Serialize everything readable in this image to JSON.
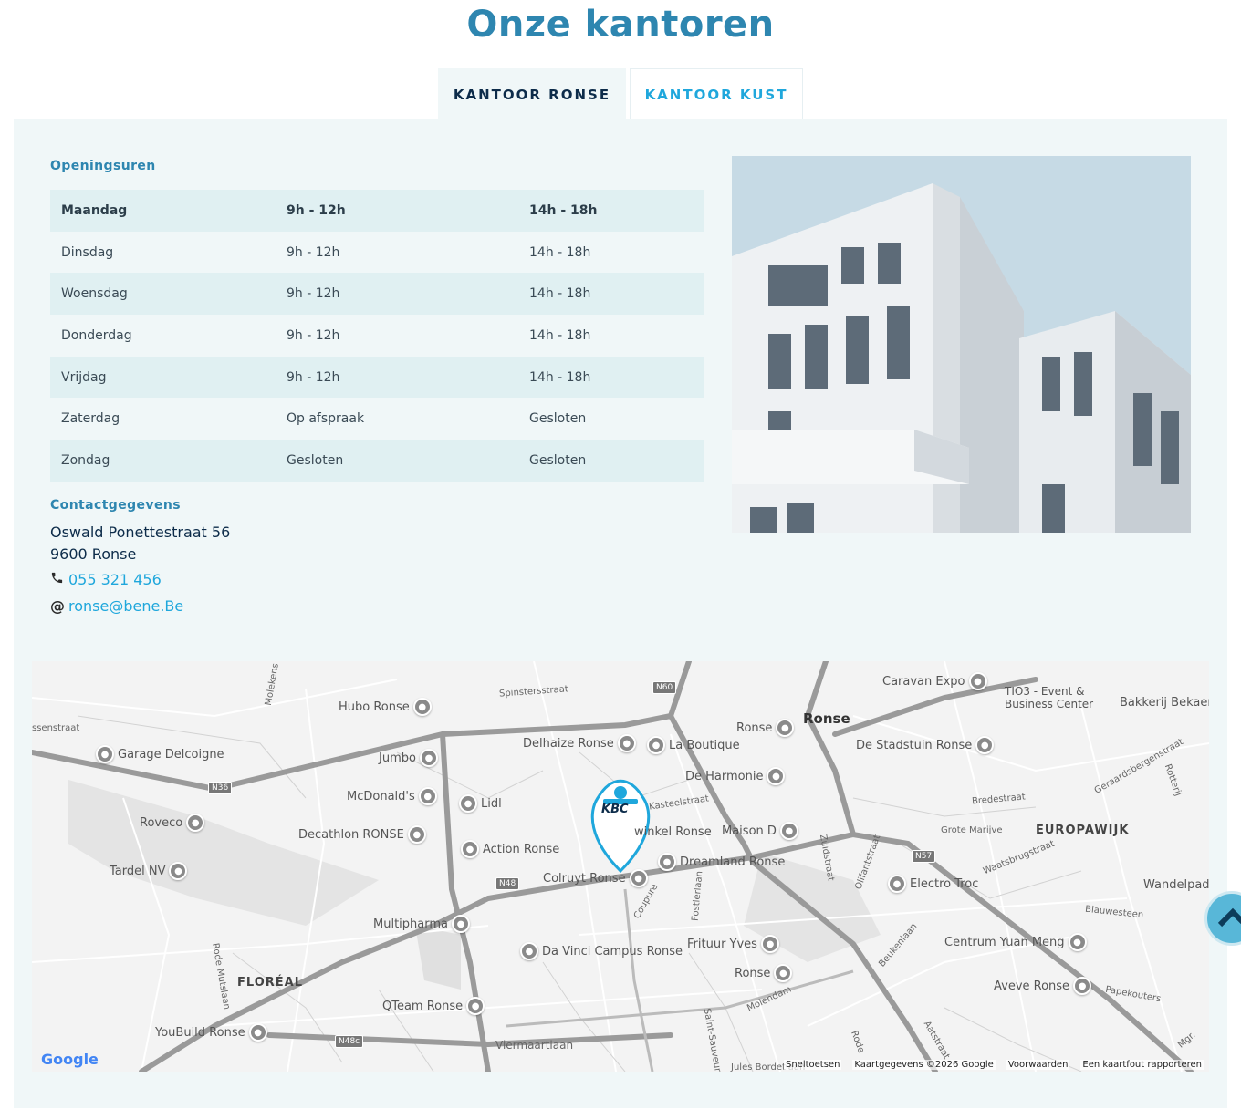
{
  "title": "Onze kantoren",
  "tabs": [
    {
      "label": "KANTOOR RONSE",
      "active": true
    },
    {
      "label": "KANTOOR KUST",
      "active": false
    }
  ],
  "hours": {
    "heading": "Openingsuren",
    "rows": [
      {
        "day": "Maandag",
        "morning": "9h - 12h",
        "afternoon": "14h - 18h"
      },
      {
        "day": "Dinsdag",
        "morning": "9h - 12h",
        "afternoon": "14h - 18h"
      },
      {
        "day": "Woensdag",
        "morning": "9h - 12h",
        "afternoon": "14h - 18h"
      },
      {
        "day": "Donderdag",
        "morning": "9h - 12h",
        "afternoon": "14h - 18h"
      },
      {
        "day": "Vrijdag",
        "morning": "9h - 12h",
        "afternoon": "14h - 18h"
      },
      {
        "day": "Zaterdag",
        "morning": "Op afspraak",
        "afternoon": "Gesloten"
      },
      {
        "day": "Zondag",
        "morning": "Gesloten",
        "afternoon": "Gesloten"
      }
    ]
  },
  "contact": {
    "heading": "Contactgegevens",
    "street": "Oswald Ponettestraat 56",
    "city": "9600 Ronse",
    "phone_icon": "phone-icon",
    "phone": "055 321 456",
    "email_icon": "@",
    "email": "ronse@bene.Be"
  },
  "map": {
    "marker_label": "KBC",
    "city": "Ronse",
    "areas": [
      "EUROPAWIJK",
      "FLORÉAL"
    ],
    "pois": [
      "Caravan Expo",
      "TIO3 - Event &",
      "Business Center",
      "Bakkerij Bekaer",
      "Hubo Ronse",
      "Ronse",
      "Garage Delcoigne",
      "Delhaize Ronse",
      "La Boutique",
      "De Stadstuin Ronse",
      "Jumbo",
      "De Harmonie",
      "McDonald's",
      "Lidl",
      "Roveco",
      "Decathlon RONSE",
      "winkel Ronse",
      "Maison D",
      "Action Ronse",
      "Dreamland Ronse",
      "Tardel NV",
      "Colruyt Ronse",
      "Electro Troc",
      "Wandelpad",
      "Multipharma",
      "Da Vinci Campus Ronse",
      "Frituur Yves",
      "Centrum Yuan Meng",
      "Ronse",
      "Aveve Ronse",
      "QTeam Ronse",
      "YouBuild Ronse"
    ],
    "roads": [
      "Spinstersstraat",
      "N60",
      "N36",
      "N48",
      "N48c",
      "N57",
      "Kasteelstraat",
      "Zuidstraat",
      "Olifantstraat",
      "Bredestraat",
      "Grote Marijve",
      "Waatsbrugstraat",
      "Geraardsbergenstraat",
      "Blauwesteen",
      "Papekouters",
      "Beukenlaan",
      "Aatstraat",
      "Molendam",
      "Viermaartlaan",
      "Rode Mutslaan",
      "Fostierlaan",
      "Coupure",
      "Jules Bordetlaan",
      "Saint-Sauveur",
      "Rode",
      "ssenstraat",
      "Molekens",
      "Rotterij",
      "Mgr."
    ],
    "footer": [
      "Sneltoetsen",
      "Kaartgegevens ©2026 Google",
      "Voorwaarden",
      "Een kaartfout rapporteren"
    ],
    "logo": "Google"
  },
  "scroll_top_icon": "chevron-up-icon",
  "colors": {
    "accent": "#2e86b0",
    "link": "#1fa7dc",
    "panel": "#f0f7f8",
    "row": "#e0f0f2",
    "marker": "#1fa7dc"
  }
}
